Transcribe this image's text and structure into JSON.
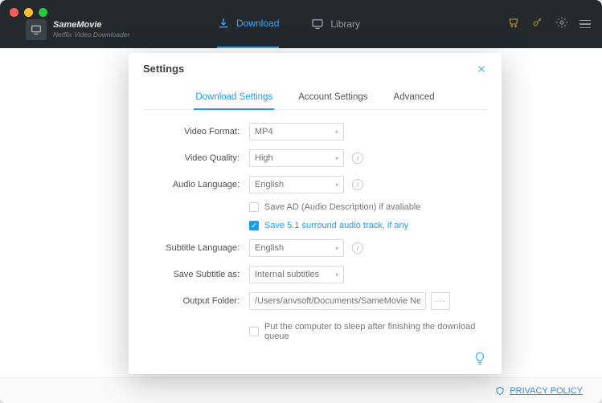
{
  "brand": {
    "title": "SameMovie",
    "subtitle": "Netflix Video Downloader"
  },
  "nav": {
    "download": "Download",
    "library": "Library"
  },
  "footer": {
    "privacy": "PRIVACY POLICY"
  },
  "modal": {
    "title": "Settings",
    "tabs": {
      "download": "Download Settings",
      "account": "Account Settings",
      "advanced": "Advanced"
    },
    "labels": {
      "video_format": "Video Format:",
      "video_quality": "Video Quality:",
      "audio_language": "Audio Language:",
      "subtitle_language": "Subtitle Language:",
      "save_subtitle_as": "Save Subtitle as:",
      "output_folder": "Output Folder:"
    },
    "values": {
      "video_format": "MP4",
      "video_quality": "High",
      "audio_language": "English",
      "subtitle_language": "English",
      "save_subtitle_as": "Internal subtitles",
      "output_folder": "/Users/anvsoft/Documents/SameMovie Netflix"
    },
    "checks": {
      "save_ad": "Save AD (Audio Description) if avaliable",
      "save_51": "Save 5.1 surround audio track, if any",
      "sleep": "Put the computer to sleep after finishing the download queue"
    },
    "browse": "···"
  }
}
